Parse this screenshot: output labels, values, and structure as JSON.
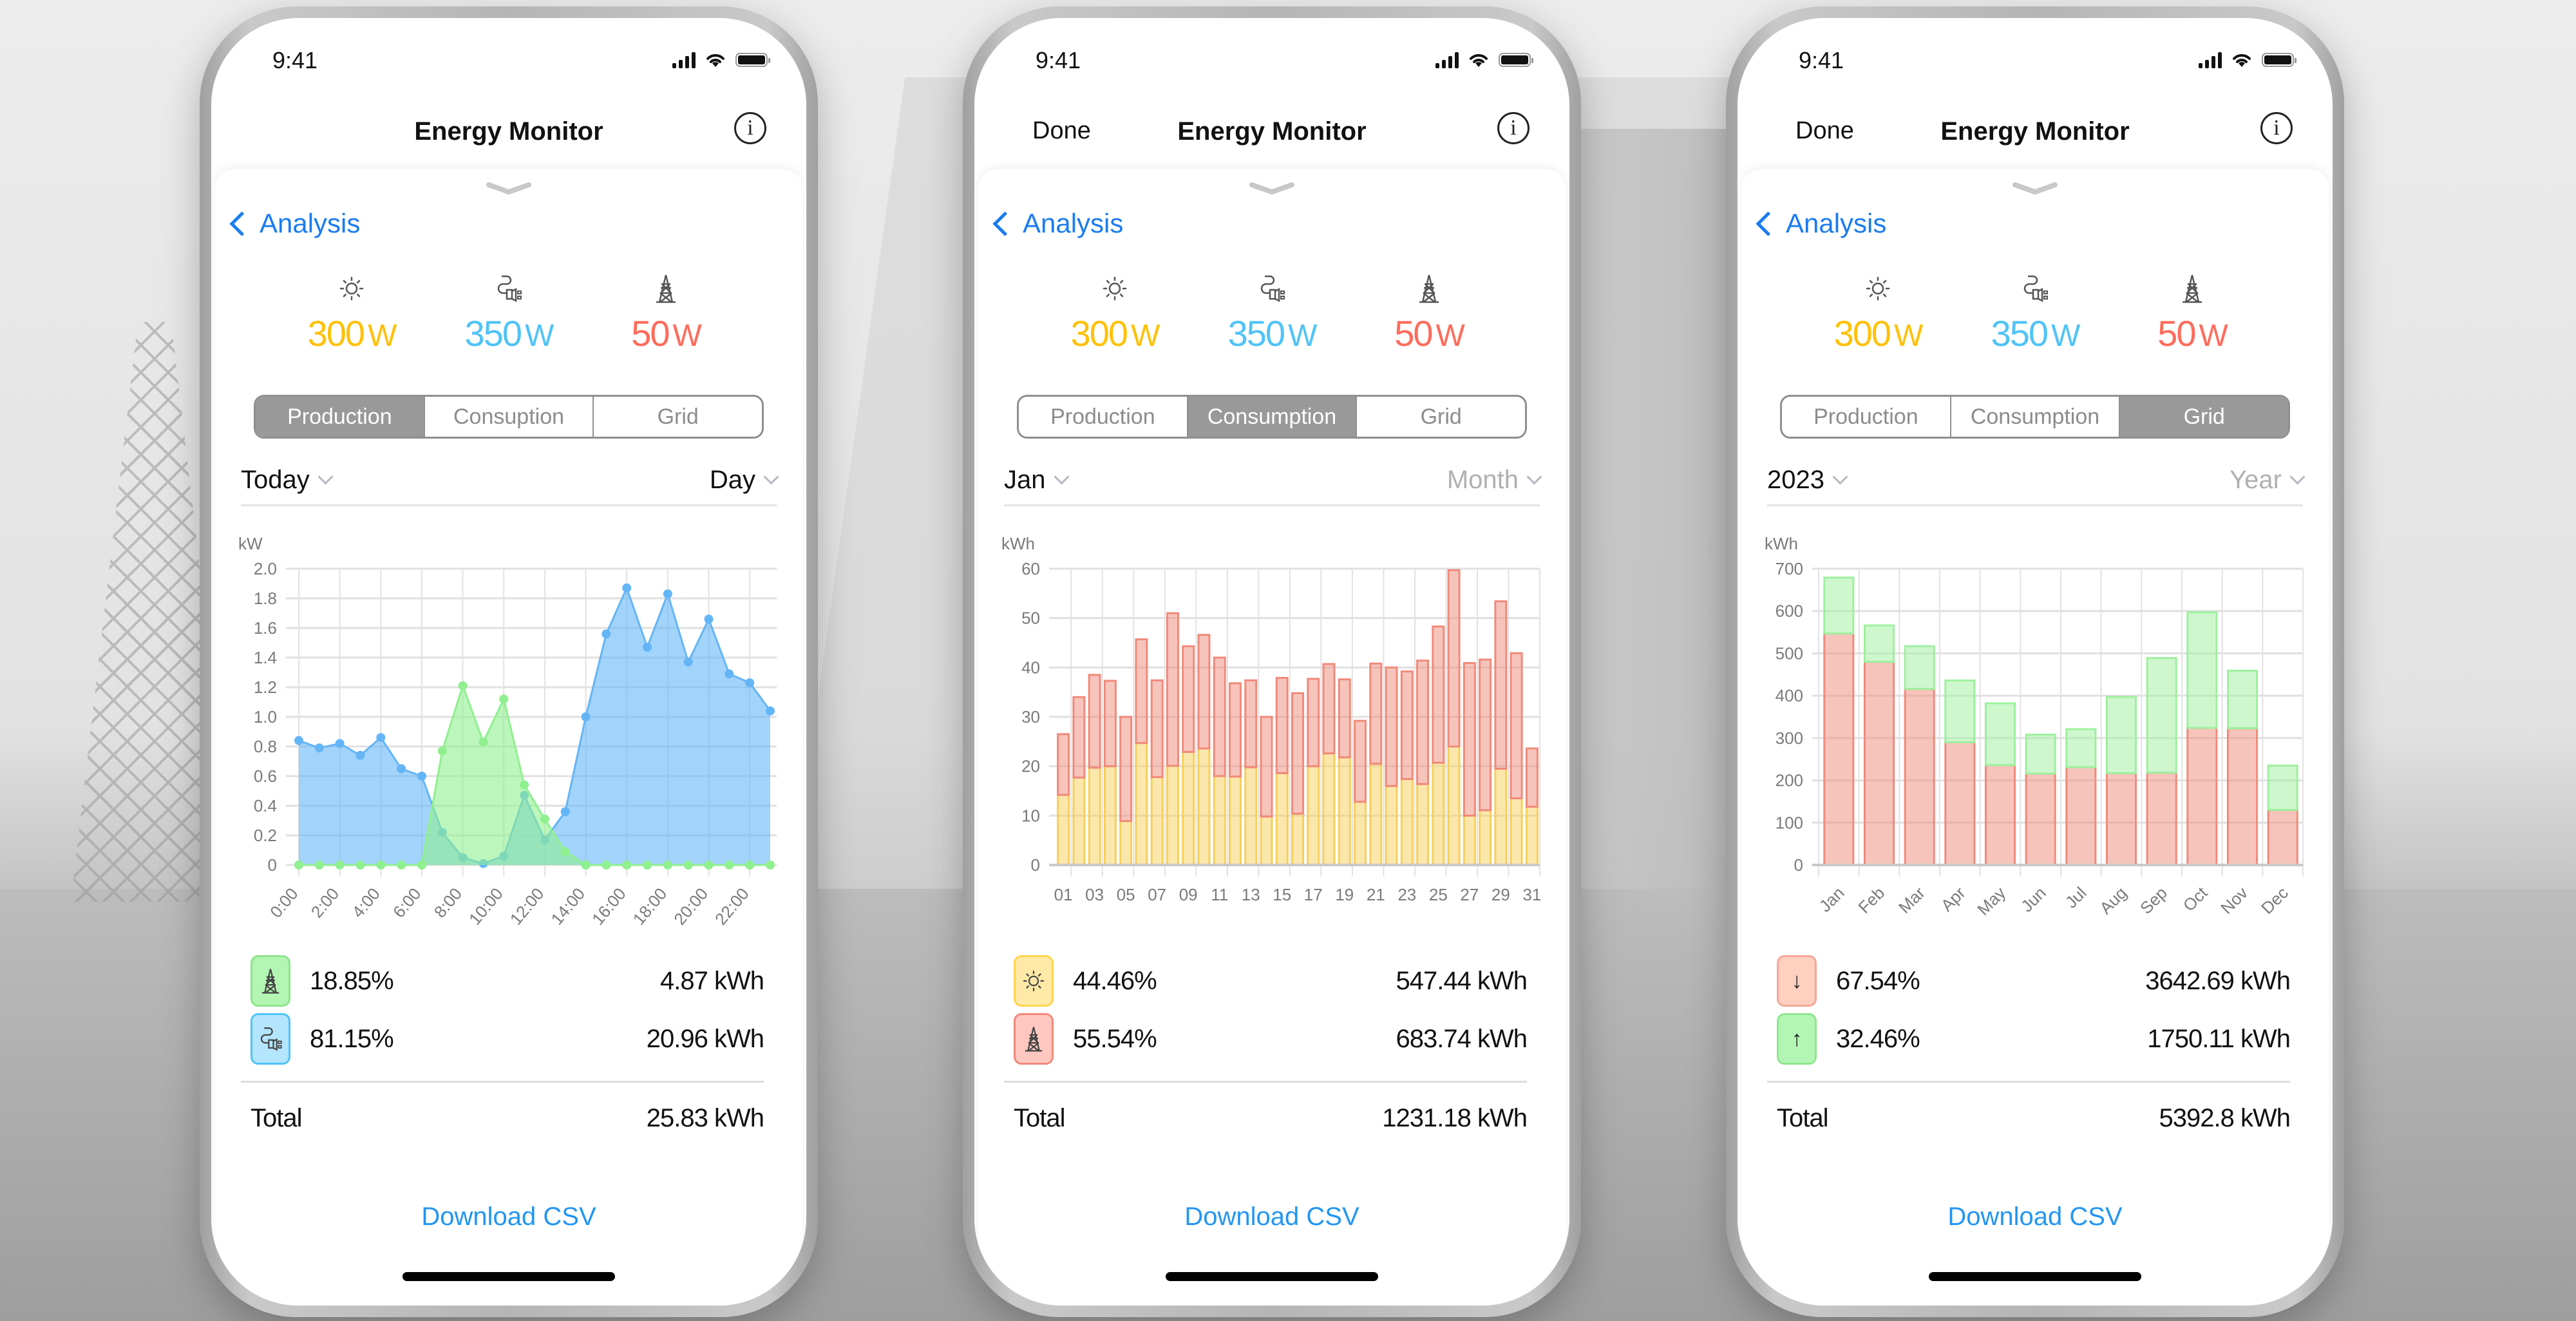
{
  "colors": {
    "solar": "#ffc107",
    "consumption": "#4fc3f7",
    "grid": "#ff6b5b",
    "link": "#1a7cf0",
    "download": "#2196f3",
    "segment_active_bg": "#999999",
    "production_series": "#8ff08f",
    "consumption_series": "#64b5f6",
    "import_series": "#f08a7a",
    "export_series": "#9ef09e",
    "solar_series": "#f7cf5a"
  },
  "common": {
    "status_time": "9:41",
    "app_title": "Energy Monitor",
    "back_label": "Analysis",
    "done_label": "Done",
    "download_label": "Download CSV",
    "total_label": "Total",
    "kpis": [
      {
        "icon": "sun-icon",
        "value": "300",
        "unit": "W"
      },
      {
        "icon": "plug-icon",
        "value": "350",
        "unit": "W"
      },
      {
        "icon": "power-tower-icon",
        "value": "50",
        "unit": "W"
      }
    ]
  },
  "phones": [
    {
      "show_done": false,
      "tabs": [
        "Production",
        "Consuption",
        "Grid"
      ],
      "active_tab": 0,
      "period_left": "Today",
      "period_right": "Day",
      "period_right_muted": false,
      "legend": [
        {
          "icon": "power-tower-icon",
          "badge": "green",
          "pct": "18.85%",
          "value": "4.87 kWh"
        },
        {
          "icon": "plug-icon",
          "badge": "blue",
          "pct": "81.15%",
          "value": "20.96 kWh"
        }
      ],
      "total": "25.83 kWh"
    },
    {
      "show_done": true,
      "tabs": [
        "Production",
        "Consumption",
        "Grid"
      ],
      "active_tab": 1,
      "period_left": "Jan",
      "period_right": "Month",
      "period_right_muted": true,
      "legend": [
        {
          "icon": "sun-icon",
          "badge": "yellow",
          "pct": "44.46%",
          "value": "547.44 kWh"
        },
        {
          "icon": "power-tower-icon",
          "badge": "red",
          "pct": "55.54%",
          "value": "683.74 kWh"
        }
      ],
      "total": "1231.18 kWh"
    },
    {
      "show_done": true,
      "tabs": [
        "Production",
        "Consumption",
        "Grid"
      ],
      "active_tab": 2,
      "period_left": "2023",
      "period_right": "Year",
      "period_right_muted": true,
      "legend": [
        {
          "icon": "arrow-down-icon",
          "badge": "salmon",
          "glyph": "↓",
          "pct": "67.54%",
          "value": "3642.69 kWh"
        },
        {
          "icon": "arrow-up-icon",
          "badge": "green",
          "glyph": "↑",
          "pct": "32.46%",
          "value": "1750.11 kWh"
        }
      ],
      "total": "5392.8 kWh"
    }
  ],
  "chart_data": [
    {
      "type": "area",
      "ylabel": "kW",
      "ylim": [
        0,
        2.0
      ],
      "yticks": [
        "0",
        "0.2",
        "0.4",
        "0.6",
        "0.8",
        "1.0",
        "1.2",
        "1.4",
        "1.6",
        "1.8",
        "2.0"
      ],
      "xtick_labels": [
        "0:00",
        "2:00",
        "4:00",
        "6:00",
        "8:00",
        "10:00",
        "12:00",
        "14:00",
        "16:00",
        "18:00",
        "20:00",
        "22:00"
      ],
      "x": [
        0,
        1,
        2,
        3,
        4,
        5,
        6,
        7,
        8,
        9,
        10,
        11,
        12,
        13,
        14,
        15,
        16,
        17,
        18,
        19,
        20,
        21,
        22,
        23
      ],
      "grid": true,
      "series": [
        {
          "name": "Consumption",
          "color": "#64b5f6",
          "values": [
            0.84,
            0.79,
            0.82,
            0.74,
            0.86,
            0.65,
            0.6,
            0.22,
            0.05,
            0.01,
            0.06,
            0.47,
            0.17,
            0.36,
            1.0,
            1.56,
            1.87,
            1.47,
            1.83,
            1.37,
            1.66,
            1.29,
            1.23,
            1.04
          ]
        },
        {
          "name": "Production",
          "color": "#8ff08f",
          "values": [
            0,
            0,
            0,
            0,
            0,
            0,
            0,
            0.77,
            1.21,
            0.83,
            1.12,
            0.54,
            0.31,
            0.09,
            0,
            0,
            0,
            0,
            0,
            0,
            0,
            0,
            0,
            0
          ]
        }
      ]
    },
    {
      "type": "bar",
      "stacked": true,
      "ylabel": "kWh",
      "ylim": [
        0,
        60
      ],
      "yticks": [
        "0",
        "10",
        "20",
        "30",
        "40",
        "50",
        "60"
      ],
      "categories": [
        "01",
        "02",
        "03",
        "04",
        "05",
        "06",
        "07",
        "08",
        "09",
        "10",
        "11",
        "12",
        "13",
        "14",
        "15",
        "16",
        "17",
        "18",
        "19",
        "20",
        "21",
        "22",
        "23",
        "24",
        "25",
        "26",
        "27",
        "28",
        "29",
        "30",
        "31"
      ],
      "xtick_labels": [
        "01",
        "03",
        "05",
        "07",
        "09",
        "11",
        "13",
        "15",
        "17",
        "19",
        "21",
        "23",
        "25",
        "27",
        "29",
        "31"
      ],
      "grid": true,
      "series": [
        {
          "name": "Solar",
          "color": "#f7cf5a",
          "values": [
            14.2,
            17.7,
            19.7,
            20.0,
            8.9,
            24.7,
            17.8,
            20.1,
            22.9,
            23.6,
            18.0,
            17.9,
            19.8,
            9.8,
            18.6,
            10.4,
            20.0,
            22.6,
            21.8,
            12.8,
            20.5,
            16.0,
            17.4,
            16.4,
            20.7,
            24.0,
            10.0,
            11.1,
            19.5,
            13.5,
            11.8
          ]
        },
        {
          "name": "Grid",
          "color": "#f08a7a",
          "values": [
            12.3,
            16.3,
            18.8,
            17.3,
            21.1,
            21.0,
            19.6,
            30.9,
            21.4,
            23.0,
            24.0,
            18.9,
            17.6,
            20.2,
            19.3,
            24.4,
            17.7,
            18.1,
            15.8,
            16.4,
            20.3,
            24.0,
            21.8,
            25.0,
            27.6,
            35.7,
            30.9,
            30.5,
            33.9,
            29.4,
            11.8
          ]
        }
      ]
    },
    {
      "type": "bar",
      "stacked": true,
      "ylabel": "kWh",
      "ylim": [
        0,
        700
      ],
      "yticks": [
        "0",
        "100",
        "200",
        "300",
        "400",
        "500",
        "600",
        "700"
      ],
      "categories": [
        "Jan",
        "Feb",
        "Mar",
        "Apr",
        "May",
        "Jun",
        "Jul",
        "Aug",
        "Sep",
        "Oct",
        "Nov",
        "Dec"
      ],
      "xtick_labels": [
        "Jan",
        "Feb",
        "Mar",
        "Apr",
        "May",
        "Jun",
        "Jul",
        "Aug",
        "Sep",
        "Oct",
        "Nov",
        "Dec"
      ],
      "grid": true,
      "series": [
        {
          "name": "Import",
          "color": "#f08a7a",
          "values": [
            547,
            480,
            416,
            290,
            236,
            216,
            231,
            217,
            218,
            324,
            323,
            130
          ]
        },
        {
          "name": "Export",
          "color": "#9ef09e",
          "values": [
            132,
            86,
            101,
            146,
            146,
            92,
            90,
            180,
            271,
            273,
            136,
            105
          ]
        }
      ]
    }
  ]
}
